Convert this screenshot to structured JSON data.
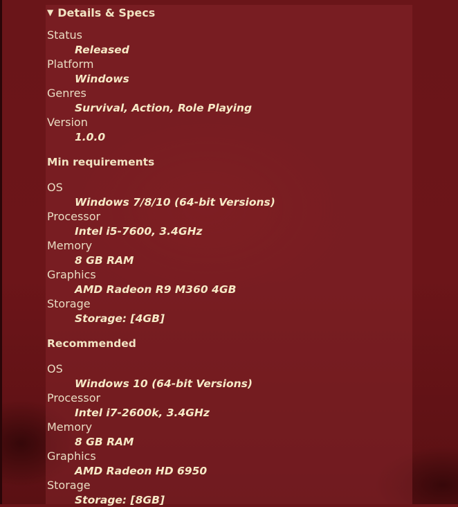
{
  "details": {
    "summary": "Details & Specs",
    "fields": [
      {
        "label": "Status",
        "value": "Released"
      },
      {
        "label": "Platform",
        "value": "Windows"
      },
      {
        "label": "Genres",
        "value": "Survival, Action, Role Playing"
      },
      {
        "label": "Version",
        "value": "1.0.0"
      }
    ]
  },
  "min_requirements": {
    "heading": "Min requirements",
    "specs": [
      {
        "label": "OS",
        "value": "Windows 7/8/10 (64-bit Versions)"
      },
      {
        "label": "Processor",
        "value": "Intel i5-7600, 3.4GHz"
      },
      {
        "label": "Memory",
        "value": "8 GB RAM"
      },
      {
        "label": "Graphics",
        "value": "AMD Radeon R9 M360 4GB"
      },
      {
        "label": "Storage",
        "value": "Storage: [4GB]"
      }
    ]
  },
  "recommended": {
    "heading": "Recommended",
    "specs": [
      {
        "label": "OS",
        "value": "Windows 10 (64-bit Versions)"
      },
      {
        "label": "Processor",
        "value": "Intel i7-2600k, 3.4GHz"
      },
      {
        "label": "Memory",
        "value": "8 GB RAM"
      },
      {
        "label": "Graphics",
        "value": "AMD Radeon HD 6950"
      },
      {
        "label": "Storage",
        "value": "Storage: [8GB]"
      }
    ]
  },
  "colors": {
    "background": "#6a1519",
    "panel": "#84242a",
    "text": "#f1e3c2"
  }
}
